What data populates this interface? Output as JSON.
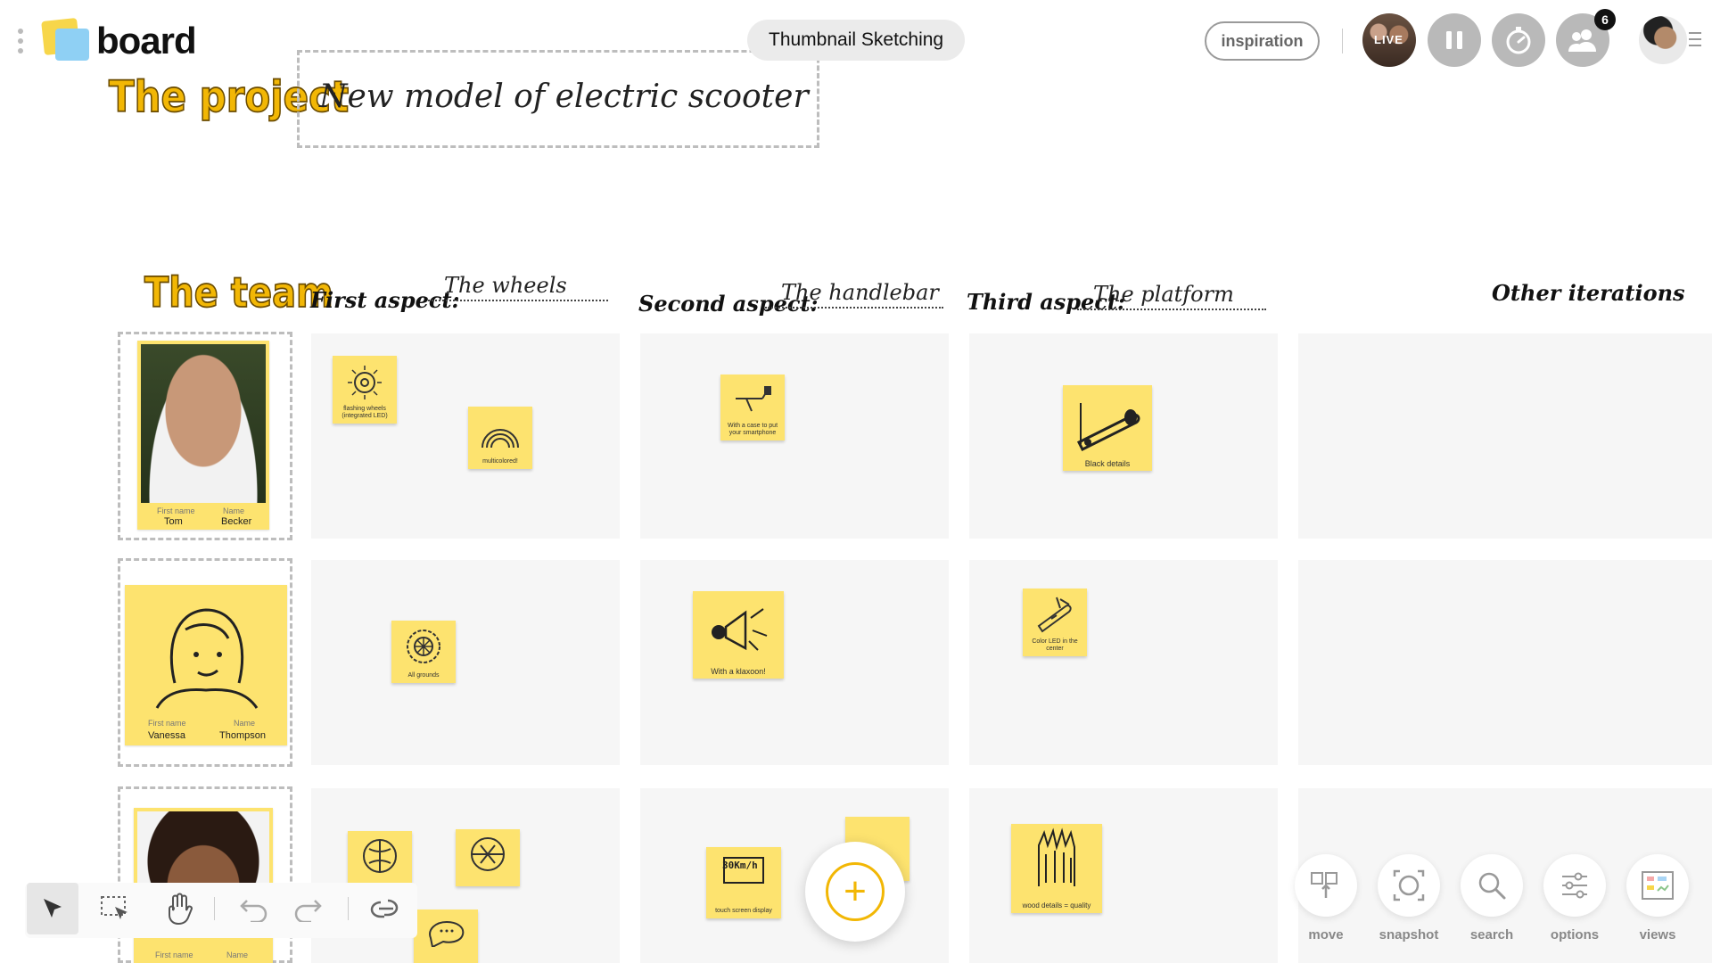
{
  "app": {
    "brand": "board"
  },
  "header": {
    "project_label": "The project",
    "project_title": "New model of electric scooter",
    "session_name": "Thumbnail Sketching",
    "inspiration_label": "inspiration",
    "live_label": "LIVE",
    "participants_count": "6"
  },
  "board": {
    "team_label": "The team",
    "aspects": [
      {
        "label": "First aspect:",
        "value": "The wheels"
      },
      {
        "label": "Second aspect:",
        "value": "The handlebar"
      },
      {
        "label": "Third aspect:",
        "value": "The platform"
      }
    ],
    "other_label": "Other iterations",
    "members": [
      {
        "first_name_label": "First name",
        "name_label": "Name",
        "first_name": "Tom",
        "name": "Becker"
      },
      {
        "first_name_label": "First name",
        "name_label": "Name",
        "first_name": "Vanessa",
        "name": "Thompson"
      },
      {
        "first_name_label": "First name",
        "name_label": "Name",
        "first_name": "",
        "name": ""
      }
    ],
    "stickies": {
      "r1c1a": "flashing wheels (integrated LED)",
      "r1c1b": "multicolored!",
      "r1c2a": "With a case to put your smartphone",
      "r1c3a": "Black details",
      "r2c1a": "All grounds",
      "r2c2a": "With a klaxoon!",
      "r2c3a": "Color LED in the center",
      "r3c2a": "touch screen display",
      "r3c3a": "wood details = quality",
      "speed_text": "30Km/h"
    }
  },
  "toolbar_right": {
    "move": "move",
    "snapshot": "snapshot",
    "search": "search",
    "options": "options",
    "views": "views"
  },
  "icons": {
    "select": "pointer-arrow-icon",
    "marquee": "marquee-select-icon",
    "hand": "hand-pan-icon",
    "undo": "undo-icon",
    "redo": "redo-icon",
    "link": "link-icon",
    "add": "plus-icon",
    "pause": "pause-icon",
    "timer": "stopwatch-icon",
    "participants": "people-icon"
  },
  "colors": {
    "accent": "#f2b705",
    "sticky": "#fde36f",
    "cell": "#f6f6f6"
  }
}
